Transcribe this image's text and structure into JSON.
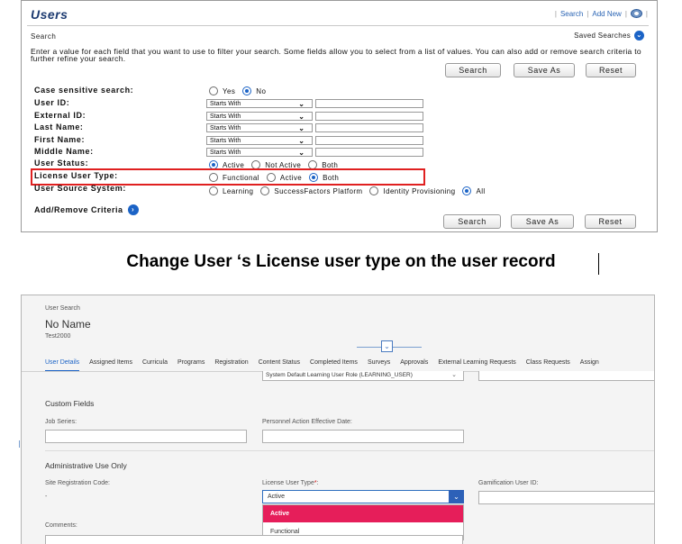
{
  "top": {
    "title": "Users",
    "links": {
      "search": "Search",
      "add_new": "Add New"
    },
    "search_label": "Search",
    "saved_searches": "Saved Searches",
    "instructions": "Enter a value for each field that you want to use to filter your search. Some fields allow you to select from a list of values. You can also add or remove search criteria to further refine your search.",
    "buttons": {
      "search": "Search",
      "save_as": "Save As",
      "reset": "Reset"
    },
    "fields": {
      "case_sensitive": {
        "label": "Case sensitive search:",
        "options": [
          "Yes",
          "No"
        ],
        "selected": "No"
      },
      "user_id": {
        "label": "User ID:",
        "operator": "Starts With",
        "value": ""
      },
      "external_id": {
        "label": "External ID:",
        "operator": "Starts With",
        "value": ""
      },
      "last_name": {
        "label": "Last Name:",
        "operator": "Starts With",
        "value": ""
      },
      "first_name": {
        "label": "First Name:",
        "operator": "Starts With",
        "value": ""
      },
      "middle_name": {
        "label": "Middle Name:",
        "operator": "Starts With",
        "value": ""
      },
      "user_status": {
        "label": "User Status:",
        "options": [
          "Active",
          "Not Active",
          "Both"
        ],
        "selected": "Active"
      },
      "license_user_type": {
        "label": "License User Type:",
        "options": [
          "Functional",
          "Active",
          "Both"
        ],
        "selected": "Both"
      },
      "user_source_system": {
        "label": "User Source System:",
        "options": [
          "Learning",
          "SuccessFactors Platform",
          "Identity Provisioning",
          "All"
        ],
        "selected": "All"
      }
    },
    "add_remove_criteria": "Add/Remove Criteria"
  },
  "caption": "Change User ‘s License user type on the user record",
  "bottom": {
    "breadcrumb": "User Search",
    "user_name": "No Name",
    "user_id": "Test2000",
    "tabs": [
      "User Details",
      "Assigned Items",
      "Curricula",
      "Programs",
      "Registration",
      "Content Status",
      "Completed Items",
      "Surveys",
      "Approvals",
      "External Learning Requests",
      "Class Requests",
      "Assign"
    ],
    "active_tab": "User Details",
    "role_select_value": "System Default Learning User Role (LEARNING_USER)",
    "custom_fields_title": "Custom Fields",
    "job_series_label": "Job Series:",
    "personnel_action_label": "Personnel Action Effective Date:",
    "admin_title": "Administrative Use Only",
    "site_reg_label": "Site Registration Code:",
    "site_reg_value": "-",
    "license_type_label": "License User Type",
    "required_mark": "*",
    "license_type_value": "Active",
    "license_type_options": [
      "Active",
      "Functional"
    ],
    "gamification_label": "Gamification User ID:",
    "comments_label": "Comments:"
  },
  "colors": {
    "accent": "#1b63c6",
    "highlight": "#e02020",
    "selected_option": "#e61e5a"
  }
}
